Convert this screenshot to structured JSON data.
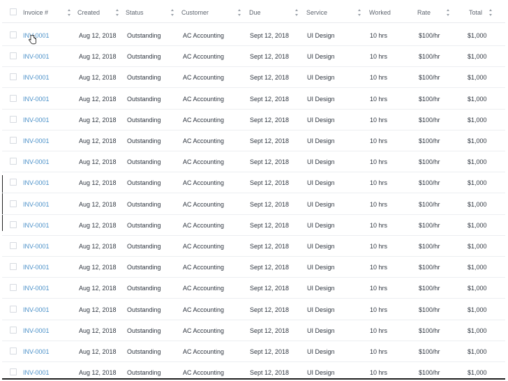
{
  "table": {
    "columns": [
      {
        "key": "invoice",
        "label": "Invoice #"
      },
      {
        "key": "created",
        "label": "Created"
      },
      {
        "key": "status",
        "label": "Status"
      },
      {
        "key": "customer",
        "label": "Customer"
      },
      {
        "key": "due",
        "label": "Due"
      },
      {
        "key": "service",
        "label": "Service"
      },
      {
        "key": "worked",
        "label": "Worked"
      },
      {
        "key": "rate",
        "label": "Rate"
      },
      {
        "key": "total",
        "label": "Total"
      }
    ],
    "rows": [
      {
        "invoice": "INV-0001",
        "created": "Aug 12, 2018",
        "status": "Outstanding",
        "customer": "AC Accounting",
        "due": "Sept 12, 2018",
        "service": "UI Design",
        "worked": "10 hrs",
        "rate": "$100/hr",
        "total": "$1,000"
      },
      {
        "invoice": "INV-0001",
        "created": "Aug 12, 2018",
        "status": "Outstanding",
        "customer": "AC Accounting",
        "due": "Sept 12, 2018",
        "service": "UI Design",
        "worked": "10 hrs",
        "rate": "$100/hr",
        "total": "$1,000"
      },
      {
        "invoice": "INV-0001",
        "created": "Aug 12, 2018",
        "status": "Outstanding",
        "customer": "AC Accounting",
        "due": "Sept 12, 2018",
        "service": "UI Design",
        "worked": "10 hrs",
        "rate": "$100/hr",
        "total": "$1,000"
      },
      {
        "invoice": "INV-0001",
        "created": "Aug 12, 2018",
        "status": "Outstanding",
        "customer": "AC Accounting",
        "due": "Sept 12, 2018",
        "service": "UI Design",
        "worked": "10 hrs",
        "rate": "$100/hr",
        "total": "$1,000"
      },
      {
        "invoice": "INV-0001",
        "created": "Aug 12, 2018",
        "status": "Outstanding",
        "customer": "AC Accounting",
        "due": "Sept 12, 2018",
        "service": "UI Design",
        "worked": "10 hrs",
        "rate": "$100/hr",
        "total": "$1,000"
      },
      {
        "invoice": "INV-0001",
        "created": "Aug 12, 2018",
        "status": "Outstanding",
        "customer": "AC Accounting",
        "due": "Sept 12, 2018",
        "service": "UI Design",
        "worked": "10 hrs",
        "rate": "$100/hr",
        "total": "$1,000"
      },
      {
        "invoice": "INV-0001",
        "created": "Aug 12, 2018",
        "status": "Outstanding",
        "customer": "AC Accounting",
        "due": "Sept 12, 2018",
        "service": "UI Design",
        "worked": "10 hrs",
        "rate": "$100/hr",
        "total": "$1,000"
      },
      {
        "invoice": "INV-0001",
        "created": "Aug 12, 2018",
        "status": "Outstanding",
        "customer": "AC Accounting",
        "due": "Sept 12, 2018",
        "service": "UI Design",
        "worked": "10 hrs",
        "rate": "$100/hr",
        "total": "$1,000"
      },
      {
        "invoice": "INV-0001",
        "created": "Aug 12, 2018",
        "status": "Outstanding",
        "customer": "AC Accounting",
        "due": "Sept 12, 2018",
        "service": "UI Design",
        "worked": "10 hrs",
        "rate": "$100/hr",
        "total": "$1,000"
      },
      {
        "invoice": "INV-0001",
        "created": "Aug 12, 2018",
        "status": "Outstanding",
        "customer": "AC Accounting",
        "due": "Sept 12, 2018",
        "service": "UI Design",
        "worked": "10 hrs",
        "rate": "$100/hr",
        "total": "$1,000"
      },
      {
        "invoice": "INV-0001",
        "created": "Aug 12, 2018",
        "status": "Outstanding",
        "customer": "AC Accounting",
        "due": "Sept 12, 2018",
        "service": "UI Design",
        "worked": "10 hrs",
        "rate": "$100/hr",
        "total": "$1,000"
      },
      {
        "invoice": "INV-0001",
        "created": "Aug 12, 2018",
        "status": "Outstanding",
        "customer": "AC Accounting",
        "due": "Sept 12, 2018",
        "service": "UI Design",
        "worked": "10 hrs",
        "rate": "$100/hr",
        "total": "$1,000"
      },
      {
        "invoice": "INV-0001",
        "created": "Aug 12, 2018",
        "status": "Outstanding",
        "customer": "AC Accounting",
        "due": "Sept 12, 2018",
        "service": "UI Design",
        "worked": "10 hrs",
        "rate": "$100/hr",
        "total": "$1,000"
      },
      {
        "invoice": "INV-0001",
        "created": "Aug 12, 2018",
        "status": "Outstanding",
        "customer": "AC Accounting",
        "due": "Sept 12, 2018",
        "service": "UI Design",
        "worked": "10 hrs",
        "rate": "$100/hr",
        "total": "$1,000"
      },
      {
        "invoice": "INV-0001",
        "created": "Aug 12, 2018",
        "status": "Outstanding",
        "customer": "AC Accounting",
        "due": "Sept 12, 2018",
        "service": "UI Design",
        "worked": "10 hrs",
        "rate": "$100/hr",
        "total": "$1,000"
      },
      {
        "invoice": "INV-0001",
        "created": "Aug 12, 2018",
        "status": "Outstanding",
        "customer": "AC Accounting",
        "due": "Sept 12, 2018",
        "service": "UI Design",
        "worked": "10 hrs",
        "rate": "$100/hr",
        "total": "$1,000"
      },
      {
        "invoice": "INV-0001",
        "created": "Aug 12, 2018",
        "status": "Outstanding",
        "customer": "AC Accounting",
        "due": "Sept 12, 2018",
        "service": "UI Design",
        "worked": "10 hrs",
        "rate": "$100/hr",
        "total": "$1,000"
      }
    ]
  },
  "colors": {
    "link": "#4a90c8",
    "text": "#2f3640",
    "header_text": "#5f6670",
    "row_border": "#eceef1"
  },
  "icons": {
    "sort": "sort-icon",
    "checkbox": "checkbox-icon",
    "cursor": "hand-pointer-cursor-icon"
  }
}
